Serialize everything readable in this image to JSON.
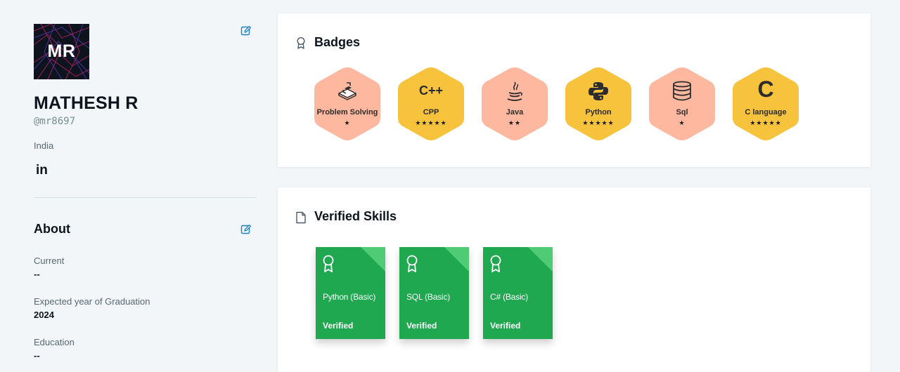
{
  "profile": {
    "initials": "MR",
    "name": "MATHESH R",
    "username": "@mr8697",
    "country": "India",
    "linkedin_label": "in"
  },
  "about": {
    "title": "About",
    "fields": [
      {
        "label": "Current",
        "value": "--"
      },
      {
        "label": "Expected year of Graduation",
        "value": "2024"
      },
      {
        "label": "Education",
        "value": "--"
      }
    ]
  },
  "badges": {
    "title": "Badges",
    "items": [
      {
        "name": "Problem Solving",
        "stars": "★",
        "icon": "problem-solving-icon",
        "color": "#ffb8a0"
      },
      {
        "name": "CPP",
        "stars": "★★★★★",
        "icon": "cpp-icon",
        "color": "#f7c23c"
      },
      {
        "name": "Java",
        "stars": "★★",
        "icon": "java-icon",
        "color": "#ffb8a0"
      },
      {
        "name": "Python",
        "stars": "★★★★★",
        "icon": "python-icon",
        "color": "#f7c23c"
      },
      {
        "name": "Sql",
        "stars": "★",
        "icon": "database-icon",
        "color": "#ffb8a0"
      },
      {
        "name": "C language",
        "stars": "★★★★★",
        "icon": "c-language-icon",
        "color": "#f7c23c"
      }
    ],
    "cpp_glyph": "C++",
    "c_glyph": "C"
  },
  "skills": {
    "title": "Verified Skills",
    "items": [
      {
        "name": "Python (Basic)",
        "status": "Verified"
      },
      {
        "name": "SQL (Basic)",
        "status": "Verified"
      },
      {
        "name": "C# (Basic)",
        "status": "Verified"
      }
    ]
  },
  "colors": {
    "page_bg": "#f3f6f8",
    "cert_green": "#1fa84f",
    "badge_peach": "#ffb8a0",
    "badge_gold": "#f7c23c",
    "edit_blue": "#1f7fc4"
  }
}
